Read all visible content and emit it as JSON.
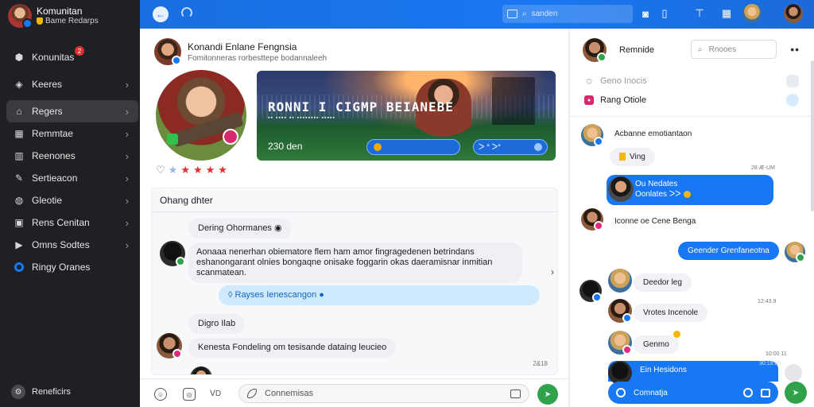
{
  "sidebar": {
    "title": "Komunitan",
    "subtitle": "Bame Redarps",
    "items": [
      {
        "label": "Konunitas",
        "icon": "community-icon",
        "badge": "2"
      },
      {
        "label": "Keeres",
        "icon": "compass-icon"
      },
      {
        "label": "Regers",
        "icon": "home-icon"
      },
      {
        "label": "Remmtae",
        "icon": "grid-icon"
      },
      {
        "label": "Reenones",
        "icon": "building-icon"
      },
      {
        "label": "Sertieacon",
        "icon": "wrench-icon"
      },
      {
        "label": "Gleotie",
        "icon": "globe-icon"
      },
      {
        "label": "Rens Cenitan",
        "icon": "camera-icon"
      },
      {
        "label": "Omns Sodtes",
        "icon": "play-icon"
      },
      {
        "label": "Ringy Oranes",
        "icon": "ring-icon"
      }
    ],
    "footer": "Reneficirs"
  },
  "topbar": {
    "search_placeholder": "sanden"
  },
  "post": {
    "author": "Konandi Enlane Fengnsia",
    "subtitle": "Fomitonneras rorbesttepe bodannaleeh",
    "banner_title": "RONNI I CIGMP BEIANEBE",
    "banner_subtitle": "▪▪ ▪▪▪▪ ▪▪ ▪▪▪▪▪▪▪▪ ▪▪▪▪▪",
    "banner_count": "230 den",
    "banner_button2": "ᐳ ᐤ ᐳᐤ",
    "rating": 4
  },
  "comments": {
    "title": "Ohang dhter",
    "items": [
      {
        "text": "Dering Ohormanes"
      },
      {
        "text": "Aonaaa nenerhan obiematore flem ham amor fingragedenen betrindans eshanongarant olnies bongaqne onisake foggarin okas daeramisnar inmitian scanmatean."
      },
      {
        "text": "Rayses Ienescangon"
      },
      {
        "text": "Digro Ilab"
      },
      {
        "text": "Kenesta Fondeling om tesisande dataing leucieo"
      }
    ],
    "time": "2&18"
  },
  "composer": {
    "gif_label": "ᐯD",
    "placeholder": "Connemisas"
  },
  "chat": {
    "name": "Remnide",
    "search_placeholder": "Rnooes",
    "rows": [
      {
        "label": "Geno Inocis"
      },
      {
        "label": "Rang Otiole"
      }
    ],
    "messages": [
      {
        "text": "Acbanne emotiantaon",
        "side": "left"
      },
      {
        "text": "Ving",
        "side": "left"
      },
      {
        "text": "Ou Nedates",
        "side": "right"
      },
      {
        "text": "Oonlates",
        "side": "right"
      },
      {
        "text": "Iconne oe Cene Benga",
        "side": "left"
      },
      {
        "text": "Geender Grenfaneotna",
        "side": "right"
      },
      {
        "text": "Deedor leg",
        "side": "left"
      },
      {
        "text": "Vrotes Incenole",
        "side": "left"
      },
      {
        "text": "Genmo",
        "side": "left"
      },
      {
        "text": "Ein Hesidons",
        "side": "right"
      }
    ],
    "input_placeholder": "Comnatja",
    "timestamps": [
      "28 Æ-UM",
      "12:43.9",
      "10:00.11",
      "30:19:00"
    ]
  }
}
